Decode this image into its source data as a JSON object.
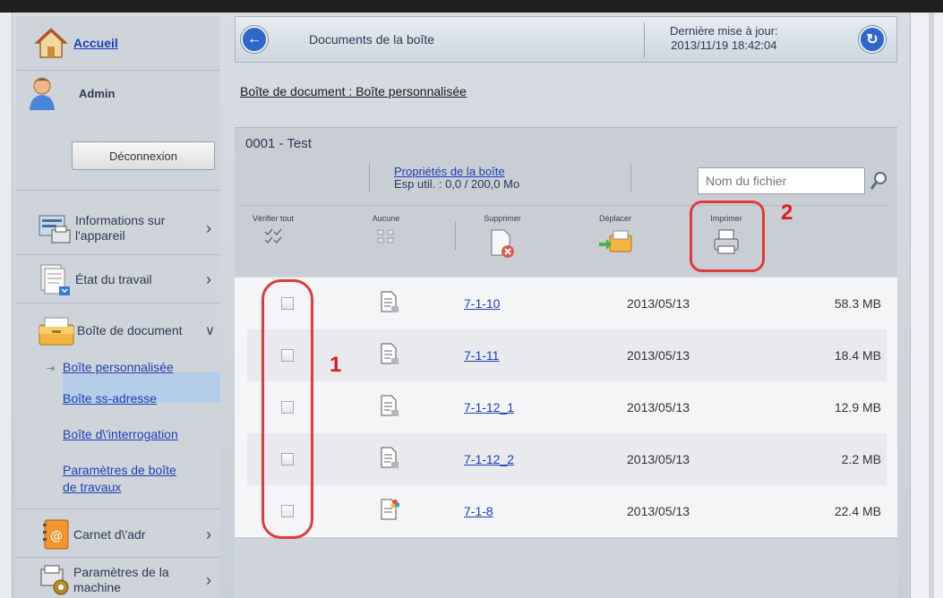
{
  "sidebar": {
    "home_label": "Accueil",
    "user_label": "Admin",
    "logout_label": "Déconnexion",
    "menu": [
      {
        "label_line1": "Informations sur",
        "label_line2": "l'appareil",
        "icon": "device-info-icon"
      },
      {
        "label": "État du travail",
        "icon": "job-status-icon"
      },
      {
        "label": "Boîte de document",
        "icon": "document-box-icon"
      }
    ],
    "submenu": [
      {
        "label": "Boîte personnalisée",
        "active": true
      },
      {
        "label": "Boîte ss-adresse"
      },
      {
        "label": "Boîte d\\'interrogation"
      },
      {
        "label_line1": "Paramètres de boîte",
        "label_line2": "de travaux"
      }
    ],
    "menu_bottom": [
      {
        "label": "Carnet d\\'adr",
        "icon": "address-book-icon"
      },
      {
        "label_line1": "Paramètres de la",
        "label_line2": "machine",
        "icon": "machine-settings-icon"
      }
    ]
  },
  "header": {
    "title": "Documents de la boîte",
    "update_label": "Dernière mise à jour:",
    "update_time": "2013/11/19 18:42:04"
  },
  "breadcrumb": "Boîte de document : Boîte personnalisée",
  "box": {
    "name": "0001 - Test",
    "properties_label": "Propriétés de la boîte",
    "usage": "Esp util. : 0,0 / 200,0 Mo",
    "search_placeholder": "Nom du fichier"
  },
  "toolbar": {
    "check_all": "Vérifier tout",
    "none": "Aucune",
    "delete": "Supprimer",
    "move": "Déplacer",
    "print": "Imprimer"
  },
  "files": [
    {
      "name": "7-1-10",
      "date": "2013/05/13",
      "size": "58.3 MB",
      "checked": false
    },
    {
      "name": "7-1-11",
      "date": "2013/05/13",
      "size": "18.4 MB",
      "checked": false
    },
    {
      "name": "7-1-12_1",
      "date": "2013/05/13",
      "size": "12.9 MB",
      "checked": false
    },
    {
      "name": "7-1-12_2",
      "date": "2013/05/13",
      "size": "2.2 MB",
      "checked": false
    },
    {
      "name": "7-1-8",
      "date": "2013/05/13",
      "size": "22.4 MB",
      "checked": false
    }
  ],
  "annotations": {
    "marker_1": "1",
    "marker_2": "2"
  },
  "colors": {
    "accent": "#2f67c9",
    "annotation": "#e03a3a",
    "link": "#1d3fb5"
  }
}
